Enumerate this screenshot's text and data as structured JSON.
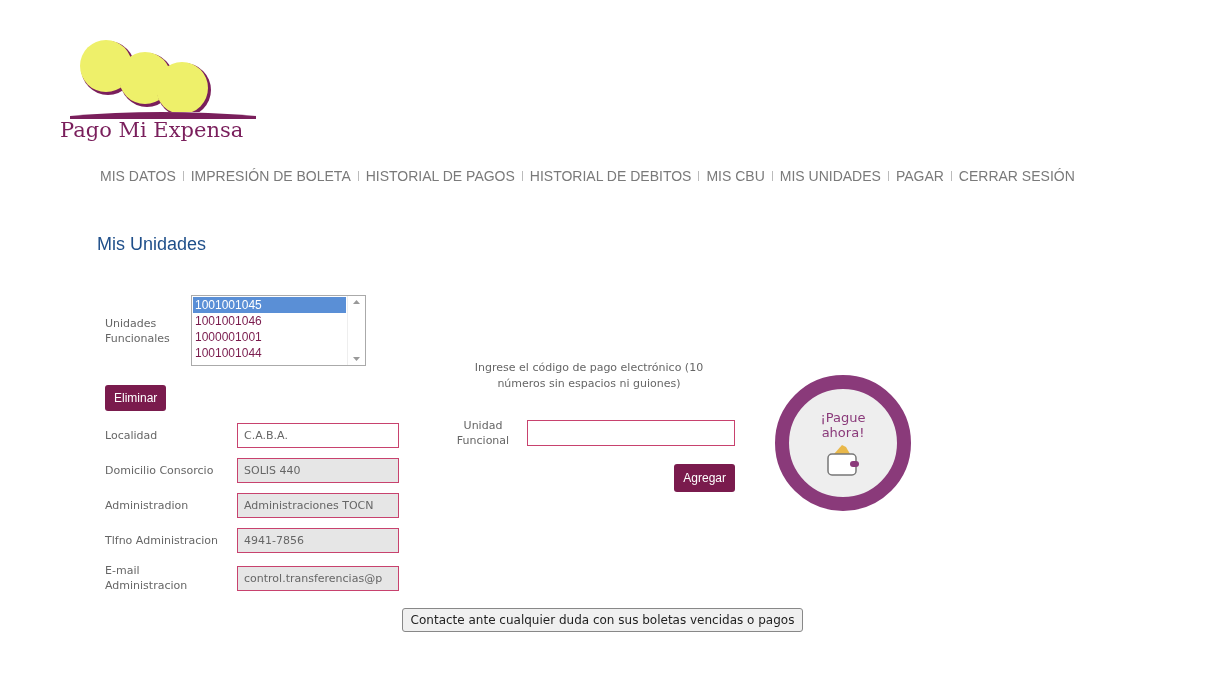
{
  "logo": {
    "text": "Pago Mi Expensa"
  },
  "nav": [
    {
      "label": "MIS DATOS",
      "selected": false
    },
    {
      "label": "IMPRESIÓN DE BOLETA",
      "selected": false
    },
    {
      "label": "HISTORIAL DE PAGOS",
      "selected": false
    },
    {
      "label": "HISTORIAL DE DEBITOS",
      "selected": false
    },
    {
      "label": "MIS CBU",
      "selected": false
    },
    {
      "label": "MIS UNIDADES",
      "selected": false
    },
    {
      "label": "PAGAR",
      "selected": false
    },
    {
      "label": "CERRAR SESIÓN",
      "selected": false
    }
  ],
  "heading": "Mis Unidades",
  "units": {
    "label": "Unidades Funcionales",
    "options": [
      {
        "label": "1001001045",
        "selected": true
      },
      {
        "label": "1001001046",
        "selected": false
      },
      {
        "label": "1000001001",
        "selected": false
      },
      {
        "label": "1001001044",
        "selected": false
      }
    ],
    "delete_button": "Eliminar"
  },
  "fields": [
    {
      "label": "Localidad",
      "value": "C.A.B.A.",
      "disabled": false
    },
    {
      "label": "Domicilio Consorcio",
      "value": "SOLIS 440",
      "disabled": true
    },
    {
      "label": "Administradion",
      "value": "Administraciones TOCN",
      "disabled": true
    },
    {
      "label": "Tlfno Administracion",
      "value": "4941-7856",
      "disabled": true
    },
    {
      "label": "E-mail Administracion",
      "value": "control.transferencias@p",
      "disabled": true
    }
  ],
  "add_unit": {
    "instructions": "Ingrese el código de pago electrónico (10 números sin espacios ni guiones)",
    "label": "Unidad Funcional",
    "button": "Agregar"
  },
  "pay_badge": {
    "text": "¡Pague ahora!"
  },
  "contact_button": "Contacte ante cualquier duda con sus boletas vencidas o pagos"
}
